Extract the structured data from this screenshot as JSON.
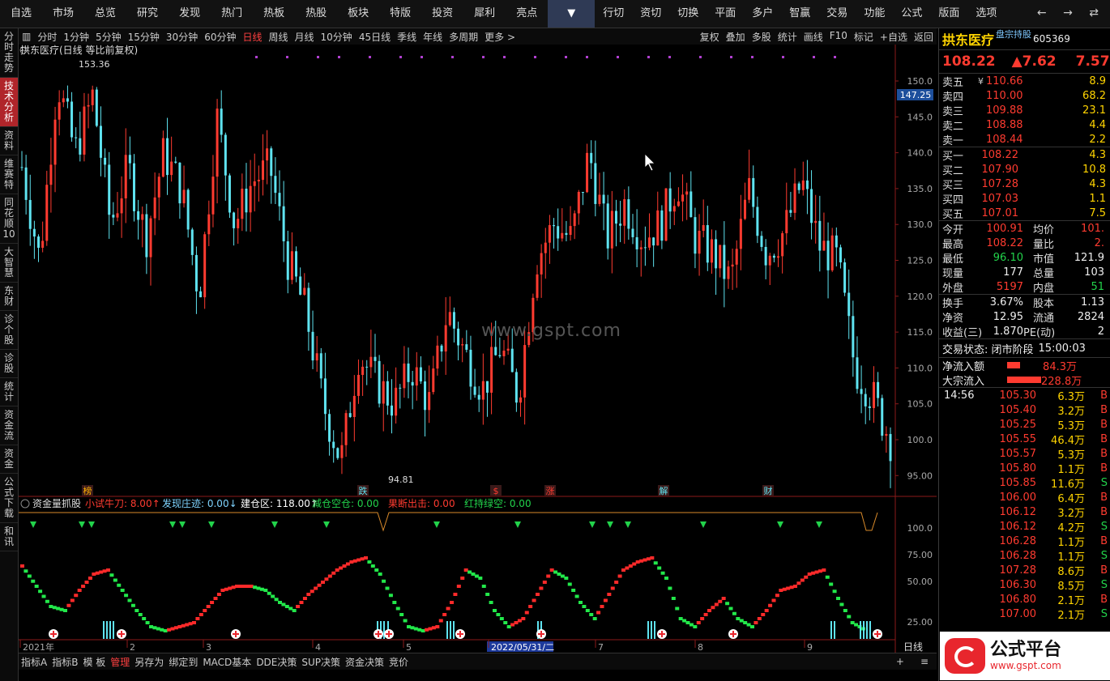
{
  "topnav": {
    "items": [
      "自选",
      "市场",
      "总览",
      "研究",
      "发现",
      "热门",
      "热板",
      "热股",
      "板块",
      "特版",
      "投资",
      "犀利",
      "亮点"
    ],
    "dropdown": "▼",
    "items_right": [
      "行切",
      "资切",
      "切换",
      "平面",
      "多户",
      "智赢",
      "交易",
      "功能",
      "公式",
      "版面",
      "选项"
    ],
    "arrows": "← → ⇄"
  },
  "leftbar": [
    "分时走势",
    "技术分析",
    "资料",
    "维赛特",
    "同花顺10",
    "大智慧",
    "东财",
    "诊个股",
    "诊股",
    "统计",
    "资金流",
    "资金",
    "公式下载",
    "和讯"
  ],
  "toolbar": {
    "periods": [
      "分时",
      "1分钟",
      "5分钟",
      "15分钟",
      "30分钟",
      "60分钟",
      "日线",
      "周线",
      "月线",
      "10分钟",
      "45日线",
      "季线",
      "年线",
      "多周期",
      "更多 >"
    ],
    "active": "日线",
    "right": [
      "复权",
      "叠加",
      "多股",
      "统计",
      "画线",
      "F10",
      "标记",
      "+自选",
      "返回"
    ]
  },
  "chart": {
    "title": "拱东医疗(日线 等比前复权)",
    "high_label": "153.36",
    "low_label": "94.81",
    "current_price_tag": "147.25",
    "y_ticks": [
      "150.0",
      "145.0",
      "140.0",
      "135.0",
      "130.0",
      "125.0",
      "120.0",
      "115.0",
      "110.0",
      "105.0",
      "100.0",
      "95.00"
    ],
    "event_markers": [
      "榜",
      "跌",
      "$",
      "涨",
      "解",
      "财"
    ],
    "indicator_header": {
      "name": "资金量抓股",
      "items": [
        {
          "label": "小试牛刀: 8.00↑",
          "color": "#ff3b30"
        },
        {
          "label": "发现庄迹: 0.00↓",
          "color": "#7fd4ff"
        },
        {
          "label": "建仓区: 118.00↑",
          "color": "#ffffff"
        },
        {
          "label": "减仓空仓: 0.00",
          "color": "#22d34b"
        },
        {
          "label": "果断出击: 0.00",
          "color": "#ff3b30"
        },
        {
          "label": "红持绿空: 0.00",
          "color": "#22d34b"
        }
      ]
    },
    "indicator_y_ticks": [
      "100.0",
      "75.00",
      "50.00",
      "25.00"
    ],
    "date_axis": [
      "2021年",
      "2",
      "3",
      "4",
      "5",
      "2022/05/31/二",
      "7",
      "8",
      "9"
    ],
    "period_label": "日线",
    "watermark": "www.gspt.com"
  },
  "bottom_tabs": [
    "指标A",
    "指标B",
    "模 板",
    "管理",
    "另存为",
    "绑定到",
    "MACD基本",
    "DDE决策",
    "SUP决策",
    "资金决策",
    "竞价"
  ],
  "bottom_active": "管理",
  "bottom_right": [
    "+",
    "≡"
  ],
  "quote": {
    "name": "拱东医疗",
    "tag": "盘宗持股",
    "code": "605369",
    "price": "108.22",
    "change": "▲7.62",
    "pct": "7.57",
    "asks": [
      {
        "label": "卖五",
        "flag": "¥",
        "price": "110.66",
        "vol": "8.9"
      },
      {
        "label": "卖四",
        "flag": "",
        "price": "110.00",
        "vol": "68.2"
      },
      {
        "label": "卖三",
        "flag": "",
        "price": "109.88",
        "vol": "23.1"
      },
      {
        "label": "卖二",
        "flag": "",
        "price": "108.88",
        "vol": "4.4"
      },
      {
        "label": "卖一",
        "flag": "",
        "price": "108.44",
        "vol": "2.2"
      }
    ],
    "bids": [
      {
        "label": "买一",
        "price": "108.22",
        "vol": "4.3"
      },
      {
        "label": "买二",
        "price": "107.90",
        "vol": "10.8"
      },
      {
        "label": "买三",
        "price": "107.28",
        "vol": "4.3"
      },
      {
        "label": "买四",
        "price": "107.03",
        "vol": "1.1"
      },
      {
        "label": "买五",
        "price": "107.01",
        "vol": "7.5"
      }
    ],
    "stats": [
      {
        "l1": "今开",
        "v1": "100.91",
        "c1": "red",
        "l2": "均价",
        "v2": "101.",
        "c2": "red"
      },
      {
        "l1": "最高",
        "v1": "108.22",
        "c1": "red",
        "l2": "量比",
        "v2": "2.",
        "c2": "red"
      },
      {
        "l1": "最低",
        "v1": "96.10",
        "c1": "grn",
        "l2": "市值",
        "v2": "121.9",
        "c2": "wht"
      },
      {
        "l1": "现量",
        "v1": "177",
        "c1": "wht",
        "l2": "总量",
        "v2": "103",
        "c2": "wht"
      },
      {
        "l1": "外盘",
        "v1": "5197",
        "c1": "red",
        "l2": "内盘",
        "v2": "51",
        "c2": "grn"
      }
    ],
    "stats2": [
      {
        "l1": "换手",
        "v1": "3.67%",
        "c1": "wht",
        "l2": "股本",
        "v2": "1.13",
        "c2": "wht"
      },
      {
        "l1": "净资",
        "v1": "12.95",
        "c1": "wht",
        "l2": "流通",
        "v2": "2824",
        "c2": "wht"
      },
      {
        "l1": "收益(三)",
        "v1": "1.870",
        "c1": "wht",
        "l2": "PE(动)",
        "v2": "2",
        "c2": "wht"
      }
    ],
    "trade_status_label": "交易状态: 闭市阶段",
    "trade_status_time": "15:00:03",
    "net_inflow_label": "净流入额",
    "net_inflow": "84.3万",
    "large_inflow_label": "大宗流入",
    "large_inflow": "228.8万",
    "ticks_time": "14:56",
    "ticks": [
      {
        "p": "105.30",
        "q": "6.3万",
        "bs": "B"
      },
      {
        "p": "105.40",
        "q": "3.2万",
        "bs": "B"
      },
      {
        "p": "105.25",
        "q": "5.3万",
        "bs": "B"
      },
      {
        "p": "105.55",
        "q": "46.4万",
        "bs": "B"
      },
      {
        "p": "105.57",
        "q": "5.3万",
        "bs": "B"
      },
      {
        "p": "105.80",
        "q": "1.1万",
        "bs": "B"
      },
      {
        "p": "105.85",
        "q": "11.6万",
        "bs": "S"
      },
      {
        "p": "106.00",
        "q": "6.4万",
        "bs": "B"
      },
      {
        "p": "106.12",
        "q": "3.2万",
        "bs": "B"
      },
      {
        "p": "106.12",
        "q": "4.2万",
        "bs": "S"
      },
      {
        "p": "106.28",
        "q": "1.1万",
        "bs": "B"
      },
      {
        "p": "106.28",
        "q": "1.1万",
        "bs": "S"
      },
      {
        "p": "107.28",
        "q": "8.6万",
        "bs": "B"
      },
      {
        "p": "106.30",
        "q": "8.5万",
        "bs": "S"
      },
      {
        "p": "106.80",
        "q": "2.1万",
        "bs": "B"
      },
      {
        "p": "107.00",
        "q": "2.1万",
        "bs": "S"
      }
    ]
  },
  "logo": {
    "big": "公式平台",
    "small": "www.gspt.com"
  }
}
